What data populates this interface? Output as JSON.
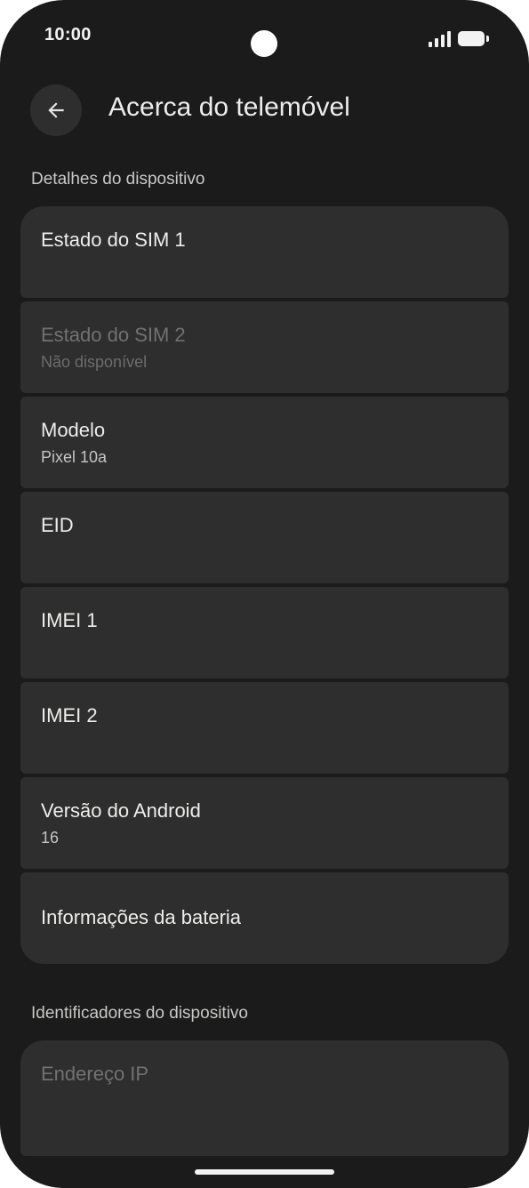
{
  "status_bar": {
    "time": "10:00"
  },
  "header": {
    "back_icon": "arrow-left-icon",
    "title": "Acerca do telemóvel"
  },
  "sections": {
    "device_details": {
      "header": "Detalhes do dispositivo",
      "items": [
        {
          "title": "Estado do SIM 1",
          "summary": "",
          "enabled": true
        },
        {
          "title": "Estado do SIM 2",
          "summary": "Não disponível",
          "enabled": false
        },
        {
          "title": "Modelo",
          "summary": "Pixel 10a",
          "enabled": true
        },
        {
          "title": "EID",
          "summary": "",
          "enabled": true
        },
        {
          "title": "IMEI 1",
          "summary": "",
          "enabled": true
        },
        {
          "title": "IMEI 2",
          "summary": "",
          "enabled": true
        },
        {
          "title": "Versão do Android",
          "summary": "16",
          "enabled": true
        },
        {
          "title": "Informações da bateria",
          "summary": "",
          "enabled": true
        }
      ]
    },
    "device_identifiers": {
      "header": "Identificadores do dispositivo",
      "items": [
        {
          "title": "Endereço IP",
          "summary": "",
          "enabled": false
        }
      ]
    }
  },
  "colors": {
    "background": "#1a1b1a",
    "card": "#2d2e2d",
    "text_primary": "#ededeb",
    "text_disabled": "#707170"
  }
}
